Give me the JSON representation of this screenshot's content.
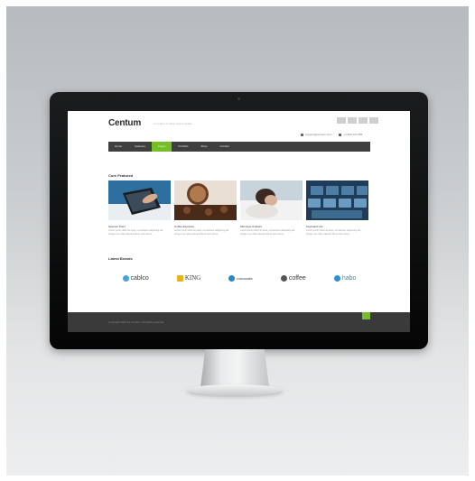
{
  "site": {
    "logo": "Centum",
    "tagline": "A modern creative web template",
    "contact": {
      "email": "support@centum.com",
      "phone": "+1 800 123 456"
    }
  },
  "nav": {
    "items": [
      "Home",
      "Features",
      "Pages",
      "Portfolio",
      "Shop",
      "Contact"
    ],
    "active_index": 2
  },
  "services_title": "Core Featured",
  "cards": [
    {
      "title": "Spencer Pixel",
      "text": "Lorem ipsum dolor sit amet, consectetur adipiscing elit. Integer nec odio praesent libero sed cursus."
    },
    {
      "title": "Coffee Espresso",
      "text": "Lorem ipsum dolor sit amet, consectetur adipiscing elit. Integer nec odio praesent libero sed cursus."
    },
    {
      "title": "Mornings Ambient",
      "text": "Lorem ipsum dolor sit amet, consectetur adipiscing elit. Integer nec odio praesent libero sed cursus."
    },
    {
      "title": "Keyboard Life",
      "text": "Lorem ipsum dolor sit amet, consectetur adipiscing elit. Integer nec odio praesent libero sed cursus."
    }
  ],
  "logos_title": "Latest Brands",
  "brands": [
    {
      "name": "cablco",
      "color": "#4aa3d8"
    },
    {
      "name": "KING",
      "color": "#e8b418"
    },
    {
      "name": "microsafe",
      "color": "#2b87c9"
    },
    {
      "name": "coffee",
      "color": "#555555"
    },
    {
      "name": "habo",
      "color": "#2d8fd6"
    }
  ],
  "footer": {
    "text": "Copyright 2014 by Centum. All rights reserved."
  },
  "colors": {
    "accent": "#75bf26",
    "nav_bg": "#3f3f3f",
    "footer_bg": "#3a3a3a"
  }
}
